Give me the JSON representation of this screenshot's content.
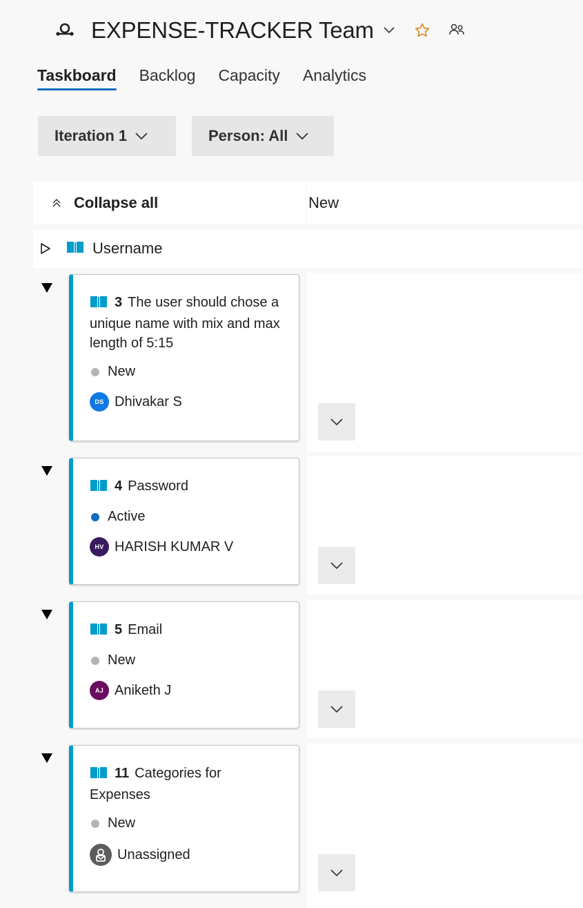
{
  "header": {
    "title": "EXPENSE-TRACKER Team",
    "icons": [
      "team-icon",
      "chevron-down-icon",
      "star-icon",
      "people-icon"
    ],
    "star_color": "#d87f0b"
  },
  "tabs": [
    {
      "label": "Taskboard",
      "active": true
    },
    {
      "label": "Backlog",
      "active": false
    },
    {
      "label": "Capacity",
      "active": false
    },
    {
      "label": "Analytics",
      "active": false
    }
  ],
  "filters": {
    "iteration": "Iteration 1",
    "person": "Person: All"
  },
  "board": {
    "collapse_all": "Collapse all",
    "column_new": "New",
    "group_label": "Username",
    "accent_color": "#009ccc"
  },
  "items": [
    {
      "id": "3",
      "title": "The user should chose a unique name with mix and max length of 5:15",
      "state": "New",
      "state_color": "#b4b4b4",
      "assignee": "Dhivakar S",
      "initials": "DS",
      "avatar_color": "#0f7ae5"
    },
    {
      "id": "4",
      "title": "Password",
      "state": "Active",
      "state_color": "#0f6cbd",
      "assignee": "HARISH KUMAR V",
      "initials": "HV",
      "avatar_color": "#3a1b5e"
    },
    {
      "id": "5",
      "title": "Email",
      "state": "New",
      "state_color": "#b4b4b4",
      "assignee": "Aniketh J",
      "initials": "AJ",
      "avatar_color": "#6a0d5f"
    },
    {
      "id": "11",
      "title": "Categories for Expenses",
      "state": "New",
      "state_color": "#b4b4b4",
      "assignee": "Unassigned",
      "initials": "",
      "avatar_color": "#5c5c5c"
    }
  ]
}
